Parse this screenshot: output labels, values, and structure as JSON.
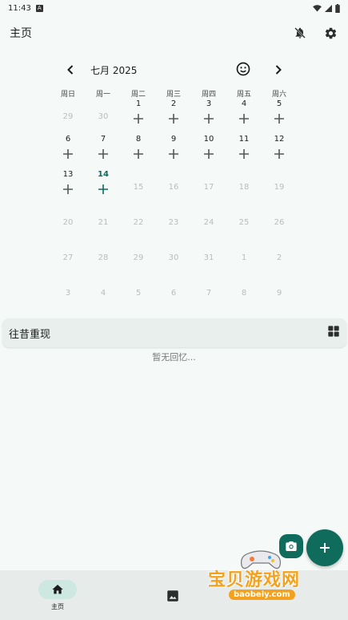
{
  "status_bar": {
    "time": "11:43",
    "badge": "A"
  },
  "app_bar": {
    "title": "主页",
    "icons": [
      "notifications-off-icon",
      "settings-icon"
    ]
  },
  "calendar": {
    "month_label": "七月 2025",
    "weekdays": [
      "周日",
      "周一",
      "周二",
      "周三",
      "周四",
      "周五",
      "周六"
    ],
    "weeks": [
      [
        {
          "n": "29",
          "t": "other"
        },
        {
          "n": "30",
          "t": "other"
        },
        {
          "n": "1",
          "t": "current"
        },
        {
          "n": "2",
          "t": "current"
        },
        {
          "n": "3",
          "t": "current"
        },
        {
          "n": "4",
          "t": "current"
        },
        {
          "n": "5",
          "t": "current"
        }
      ],
      [
        {
          "n": "6",
          "t": "current"
        },
        {
          "n": "7",
          "t": "current"
        },
        {
          "n": "8",
          "t": "current"
        },
        {
          "n": "9",
          "t": "current"
        },
        {
          "n": "10",
          "t": "current"
        },
        {
          "n": "11",
          "t": "current"
        },
        {
          "n": "12",
          "t": "current"
        }
      ],
      [
        {
          "n": "13",
          "t": "current"
        },
        {
          "n": "14",
          "t": "today"
        },
        {
          "n": "15",
          "t": "other"
        },
        {
          "n": "16",
          "t": "other"
        },
        {
          "n": "17",
          "t": "other"
        },
        {
          "n": "18",
          "t": "other"
        },
        {
          "n": "19",
          "t": "other"
        }
      ],
      [
        {
          "n": "20",
          "t": "other"
        },
        {
          "n": "21",
          "t": "other"
        },
        {
          "n": "22",
          "t": "other"
        },
        {
          "n": "23",
          "t": "other"
        },
        {
          "n": "24",
          "t": "other"
        },
        {
          "n": "25",
          "t": "other"
        },
        {
          "n": "26",
          "t": "other"
        }
      ],
      [
        {
          "n": "27",
          "t": "other"
        },
        {
          "n": "28",
          "t": "other"
        },
        {
          "n": "29",
          "t": "other"
        },
        {
          "n": "30",
          "t": "other"
        },
        {
          "n": "31",
          "t": "other"
        },
        {
          "n": "1",
          "t": "other"
        },
        {
          "n": "2",
          "t": "other"
        }
      ],
      [
        {
          "n": "3",
          "t": "other"
        },
        {
          "n": "4",
          "t": "other"
        },
        {
          "n": "5",
          "t": "other"
        },
        {
          "n": "6",
          "t": "other"
        },
        {
          "n": "7",
          "t": "other"
        },
        {
          "n": "8",
          "t": "other"
        },
        {
          "n": "9",
          "t": "other"
        }
      ]
    ]
  },
  "memories": {
    "title": "往昔重现",
    "empty_text": "暂无回忆..."
  },
  "bottom_nav": {
    "home_label": "主页"
  },
  "watermark": {
    "text": "宝贝游戏网",
    "url": "baobeiy.com"
  },
  "colors": {
    "accent": "#0f6b5c",
    "background": "#f5faf8",
    "nav_pill": "#cde8e1"
  }
}
